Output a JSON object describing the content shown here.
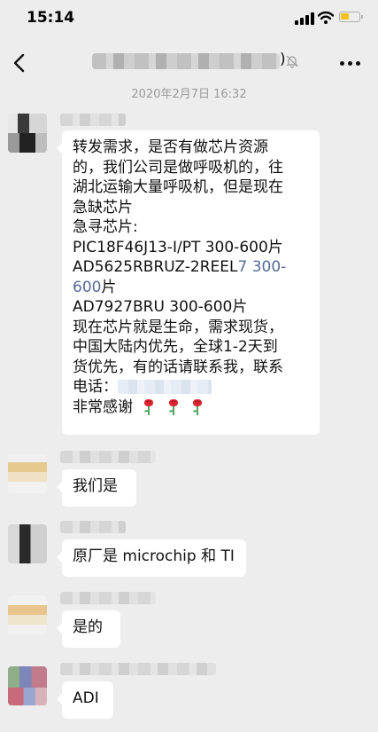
{
  "status_bar": {
    "time": "15:14"
  },
  "header": {
    "title_suffix": ")"
  },
  "chat": {
    "timestamp": "2020年2月7日 16:32",
    "messages": [
      {
        "lines": [
          "转发需求，是否有做芯片资源",
          "的，我们公司是做呼吸机的，往",
          "湖北运输大量呼吸机，但是现在",
          "急缺芯片",
          "急寻芯片:",
          "PIC18F46J13-I/PT   300-600片"
        ],
        "line_ad5625_a": "AD5625RBRUZ-2REEL",
        "line_ad5625_b": "7 300-",
        "line_600_a": "600",
        "line_600_b": "片",
        "line_ad7927": "AD7927BRU 300-600片",
        "lines2": [
          "现在芯片就是生命，需求现货，",
          "中国大陆内优先，全球1-2天到",
          "货优先，有的话请联系我，联系"
        ],
        "phone_label": "电话：",
        "thanks": "非常感谢"
      },
      {
        "text": "我们是"
      },
      {
        "text": "原厂是 microchip 和 TI"
      },
      {
        "text": "是的"
      },
      {
        "text": "ADI"
      }
    ]
  },
  "colors": {
    "background": "#ededed",
    "bubble": "#ffffff",
    "link": "#576b95",
    "timestamp": "#9a9a9a"
  },
  "icons": [
    "back-icon",
    "mute-bell-icon",
    "more-icon",
    "signal-icon",
    "wifi-icon",
    "battery-icon",
    "rose-emoji-icon"
  ]
}
